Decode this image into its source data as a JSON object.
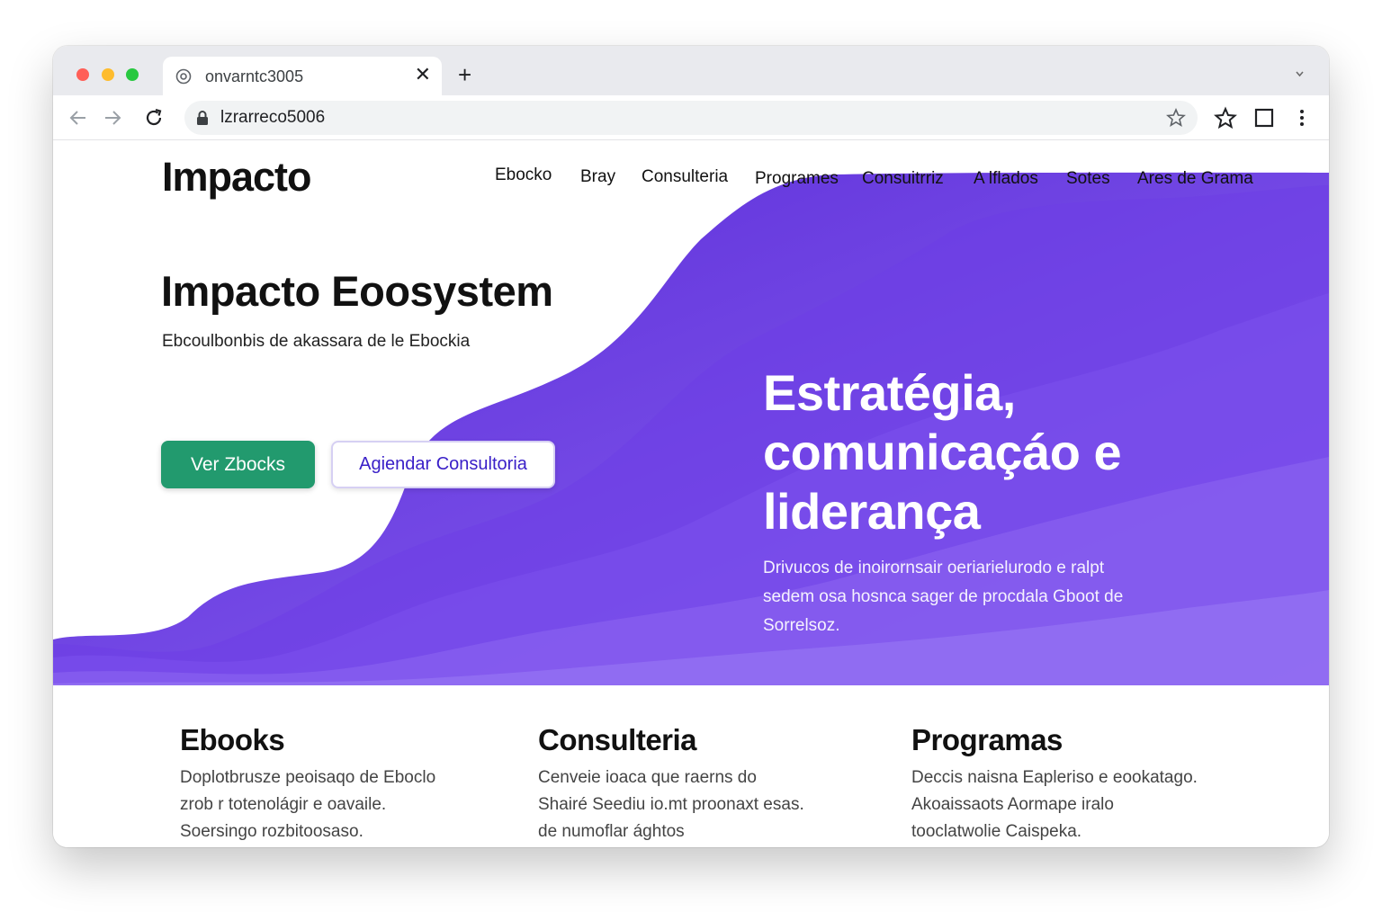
{
  "browser": {
    "tab_title": "onvarntc3005",
    "url": "lzrarreco5006"
  },
  "site": {
    "logo": "Impacto",
    "nav": [
      "Ebocko",
      "Bray",
      "Consulteria",
      "Programes",
      "Consuitrriz",
      "A lflados",
      "Sotes",
      "Ares de Grama"
    ]
  },
  "hero": {
    "title": "Impacto Eoosystem",
    "subtitle": "Ebcoulbonbis de akassara de le Ebockia",
    "primary_button": "Ver Zbocks",
    "secondary_button": "Agiendar Consultoria",
    "heading_lines": [
      "Estratégia,",
      "comunicaçáo e",
      "liderança"
    ],
    "description_lines": [
      "Drivucos de inoirornsair oeriarielurodo e ralpt",
      "sedem osa hosnca sager de procdala Gboot de",
      "Sorrelsoz."
    ]
  },
  "features": [
    {
      "title": "Ebooks",
      "lines": [
        "Doplotbrusze peoisaqo de Eboclo",
        "zrob r totenolágir e oavaile.",
        "Soersingo rozbitoosaso."
      ]
    },
    {
      "title": "Consulteria",
      "lines": [
        "Cenveie ioaca que raerns do",
        "Shairé Seediu io.mt proonaxt esas.",
        "de numoflar ághtos"
      ]
    },
    {
      "title": "Programas",
      "lines": [
        "Deccis naisna Eapleriso e eookatago.",
        "Akoaissaots Aormape iralo",
        "tooclatwolie Caispeka."
      ]
    }
  ],
  "colors": {
    "hero_purple": "#7447e8",
    "primary_green": "#229a6e",
    "secondary_text": "#3a20c8"
  }
}
